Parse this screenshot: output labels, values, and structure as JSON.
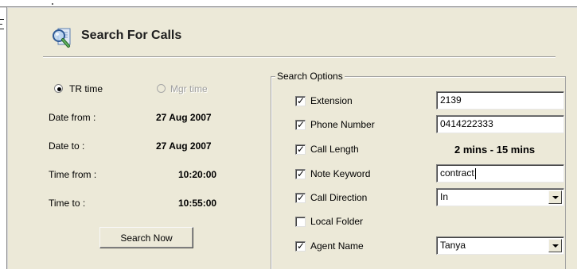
{
  "window": {
    "title": "Search For Calls",
    "icon": "magnifier-document-icon"
  },
  "time_mode": {
    "options": [
      {
        "label": "TR time",
        "selected": true,
        "enabled": true
      },
      {
        "label": "Mgr time",
        "selected": false,
        "enabled": false
      }
    ]
  },
  "range": {
    "date_from_label": "Date from :",
    "date_from": "27 Aug 2007",
    "date_to_label": "Date to :",
    "date_to": "27 Aug 2007",
    "time_from_label": "Time from :",
    "time_from": "10:20:00",
    "time_to_label": "Time to :",
    "time_to": "10:55:00"
  },
  "search_button_label": "Search Now",
  "search_options": {
    "legend": "Search Options",
    "items": [
      {
        "label": "Extension",
        "checked": true,
        "value": "2139",
        "kind": "text"
      },
      {
        "label": "Phone Number",
        "checked": true,
        "value": "0414222333",
        "kind": "text"
      },
      {
        "label": "Call Length",
        "checked": true,
        "value": "2 mins - 15 mins",
        "kind": "static"
      },
      {
        "label": "Note Keyword",
        "checked": true,
        "value": "contract",
        "kind": "text-focused"
      },
      {
        "label": "Call Direction",
        "checked": true,
        "value": "In",
        "kind": "dropdown"
      },
      {
        "label": "Local Folder",
        "checked": false,
        "value": "",
        "kind": "none"
      },
      {
        "label": "Agent Name",
        "checked": true,
        "value": "Tanya",
        "kind": "dropdown"
      }
    ]
  },
  "colors": {
    "panel_bg": "#ece9d8",
    "field_bg": "#ffffff"
  }
}
